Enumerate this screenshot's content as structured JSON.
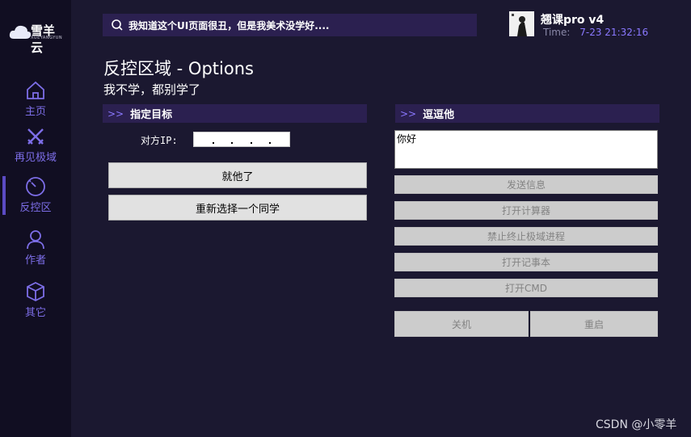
{
  "app": {
    "logo_text": "雪羊云",
    "logo_sub": "XUEYANGYUN"
  },
  "nav": {
    "items": [
      {
        "label": "主页",
        "icon": "home-icon"
      },
      {
        "label": "再见极域",
        "icon": "swords-icon"
      },
      {
        "label": "反控区",
        "icon": "gauge-icon"
      },
      {
        "label": "作者",
        "icon": "user-icon"
      },
      {
        "label": "其它",
        "icon": "cube-icon"
      }
    ],
    "active": "反控区"
  },
  "header": {
    "search_text": "我知道这个UI页面很丑，但是我美术没学好....",
    "user_name": "翘课pro v4",
    "time_label": "Time:",
    "time_value": "7-23 21:32:16"
  },
  "page": {
    "title": "反控区域 - Options",
    "subtitle": "我不学，都别学了"
  },
  "target_section": {
    "chevron": ">>",
    "title": "指定目标",
    "ip_label": "对方IP:",
    "btn_go": "就他了",
    "btn_reselect": "重新选择一个同学"
  },
  "tease_section": {
    "chevron": ">>",
    "title": "逗逗他",
    "message": "你好",
    "btn_send": "发送信息",
    "btn_calc": "打开计算器",
    "btn_kill": "禁止终止极域进程",
    "btn_notepad": "打开记事本",
    "btn_cmd": "打开CMD",
    "btn_shutdown": "关机",
    "btn_restart": "重启"
  },
  "watermark": "CSDN @小零羊",
  "colors": {
    "background": "#1b1830",
    "sidebar": "#110e22",
    "accent": "#7d6ee8",
    "header_bar": "#2b2050"
  }
}
